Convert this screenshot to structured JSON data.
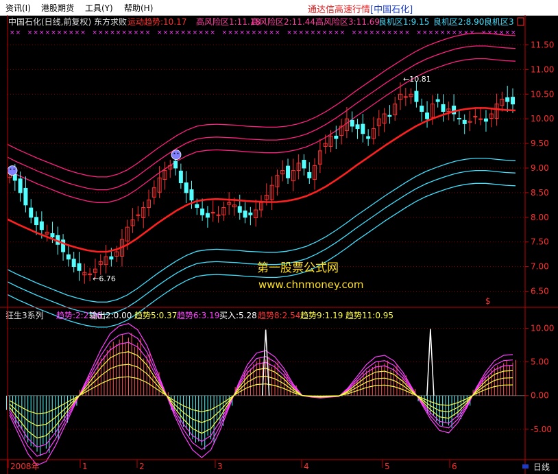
{
  "menu": {
    "items": [
      {
        "label": "资讯(I)"
      },
      {
        "label": "港股期货"
      },
      {
        "label": "工具(Y)"
      },
      {
        "label": "帮助(H)"
      }
    ],
    "app_title": "通达信高速行情",
    "stock_tag": "[中国石化]"
  },
  "colors": {
    "background": "#000000",
    "axis": "#c00000",
    "grid": "#8b0000",
    "up_candle": "#ff3030",
    "down_candle": "#54ffff",
    "mid_line": "#ff2020",
    "upper_band": "#ff2080",
    "lower_band": "#40e0ff",
    "osc_yellow": "#ffff40",
    "osc_magenta": "#ff40ff",
    "osc_white": "#ffffff"
  },
  "chart_data": [
    {
      "type": "candlestick",
      "title": "中国石化(日线,前复权) 东方求败",
      "header_items": [
        {
          "text": "运动趋势:10.17",
          "color": "#ff3030"
        },
        {
          "text": "高风险区1:11.18",
          "color": "#ff40a0"
        },
        {
          "text": "高风险区2:11.44",
          "color": "#ff40a0"
        },
        {
          "text": "高风险区3:11.69",
          "color": "#ff40a0"
        },
        {
          "text": "良机区1:9.15",
          "color": "#40e0ff"
        },
        {
          "text": "良机区2:8.90",
          "color": "#40e0ff"
        },
        {
          "text": "良机区3",
          "color": "#40e0ff"
        }
      ],
      "ylim": [
        6.2,
        11.8
      ],
      "yticks": [
        6.5,
        7.0,
        7.5,
        8.0,
        8.5,
        9.0,
        9.5,
        10.0,
        10.5,
        11.0,
        11.5
      ],
      "ytick_labels": [
        "6.50",
        "7.00",
        "7.50",
        "8.00",
        "8.50",
        "9.00",
        "9.50",
        "10.00",
        "10.50",
        "11.00",
        "11.50"
      ],
      "close_trend": [
        8.9,
        8.75,
        8.5,
        8.25,
        8.0,
        7.85,
        7.75,
        7.7,
        7.6,
        7.45,
        7.3,
        7.15,
        7.0,
        6.92,
        6.88,
        6.85,
        6.95,
        7.1,
        7.2,
        7.15,
        7.3,
        7.55,
        7.8,
        7.95,
        8.05,
        8.2,
        8.35,
        8.6,
        8.8,
        8.95,
        9.05,
        9.0,
        8.7,
        8.5,
        8.35,
        8.2,
        8.05,
        8.0,
        8.1,
        8.05,
        8.2,
        8.3,
        8.25,
        8.1,
        8.0,
        8.05,
        8.15,
        8.3,
        8.45,
        8.65,
        8.85,
        8.95,
        8.8,
        8.95,
        9.1,
        9.0,
        8.8,
        9.05,
        9.35,
        9.5,
        9.65,
        9.6,
        9.85,
        10.0,
        9.85,
        9.8,
        9.7,
        9.6,
        9.8,
        10.0,
        10.1,
        10.05,
        10.3,
        10.5,
        10.45,
        10.5,
        10.35,
        10.15,
        10.0,
        10.3,
        10.35,
        10.15,
        10.2,
        10.1,
        10.0,
        9.9,
        9.95,
        10.05,
        10.0,
        9.95,
        10.1,
        10.3,
        10.4,
        10.35,
        10.3
      ],
      "mid_line": [
        7.96,
        7.86,
        7.77,
        7.68,
        7.6,
        7.52,
        7.44,
        7.38,
        7.33,
        7.3,
        7.3,
        7.35,
        7.44,
        7.57,
        7.72,
        7.87,
        8.01,
        8.14,
        8.25,
        8.33,
        8.36,
        8.37,
        8.36,
        8.35,
        8.33,
        8.32,
        8.31,
        8.31,
        8.33,
        8.37,
        8.43,
        8.52,
        8.63,
        8.76,
        8.9,
        9.05,
        9.19,
        9.33,
        9.47,
        9.6,
        9.73,
        9.85,
        9.95,
        10.03,
        10.1,
        10.16,
        10.2,
        10.22,
        10.22,
        10.2,
        10.18,
        10.17
      ],
      "upper_bands_offset": [
        1.0,
        1.26,
        1.52
      ],
      "lower_bands_offset": [
        -1.02,
        -1.27,
        -1.53
      ],
      "annotations": [
        {
          "text": "10.81",
          "series_index": 73
        },
        {
          "text": "6.76",
          "series_index": 15
        }
      ],
      "watermark": [
        "第一股票公式网",
        "www.chnmoney.com"
      ],
      "signal_marker": "$"
    },
    {
      "type": "oscillator",
      "title": "狂生3系列",
      "legend": [
        {
          "text": "趋势:2:2.26",
          "color": "#ff40ff"
        },
        {
          "text": "输出2:0.00",
          "color": "#ffffff"
        },
        {
          "text": "趋势5:0.37",
          "color": "#ffff40"
        },
        {
          "text": "趋势6:3.19",
          "color": "#ff40ff"
        },
        {
          "text": "买入:5.28",
          "color": "#ffffff"
        },
        {
          "text": "趋势8:2.54",
          "color": "#ff3030"
        },
        {
          "text": "趋势9:1.19",
          "color": "#ffff40"
        },
        {
          "text": "趋势11:0.95",
          "color": "#ffff40"
        }
      ],
      "ylim": [
        -9.5,
        12.5
      ],
      "yticks": [
        10,
        5,
        0,
        -5
      ],
      "ytick_labels": [
        "10.00",
        "5.00",
        "0.00",
        "-5.00"
      ],
      "bars": [
        -2.5,
        -5.0,
        -7.5,
        -9.0,
        -8.5,
        -6.5,
        -4.0,
        -1.5,
        1.0,
        3.5,
        6.0,
        8.0,
        9.0,
        9.3,
        8.5,
        6.5,
        3.5,
        0.5,
        -2.5,
        -5.0,
        -7.0,
        -8.0,
        -7.0,
        -4.5,
        -1.5,
        1.5,
        4.0,
        5.5,
        5.8,
        5.0,
        3.5,
        1.5,
        0.0,
        -0.2,
        -0.3,
        -0.2,
        -0.1,
        1.0,
        2.5,
        4.0,
        5.0,
        5.2,
        4.5,
        3.0,
        1.0,
        -1.0,
        -3.0,
        -4.5,
        -4.8,
        -3.5,
        -1.5,
        1.0,
        3.0,
        4.5,
        5.2,
        5.3
      ],
      "spikes": [
        {
          "index": 28,
          "value": 9.8
        },
        {
          "index": 46,
          "value": 9.9
        }
      ],
      "x_ticks": [
        "2008年",
        "1",
        "2",
        "3",
        "4",
        "5",
        "6"
      ],
      "footer_label": "日线"
    }
  ]
}
